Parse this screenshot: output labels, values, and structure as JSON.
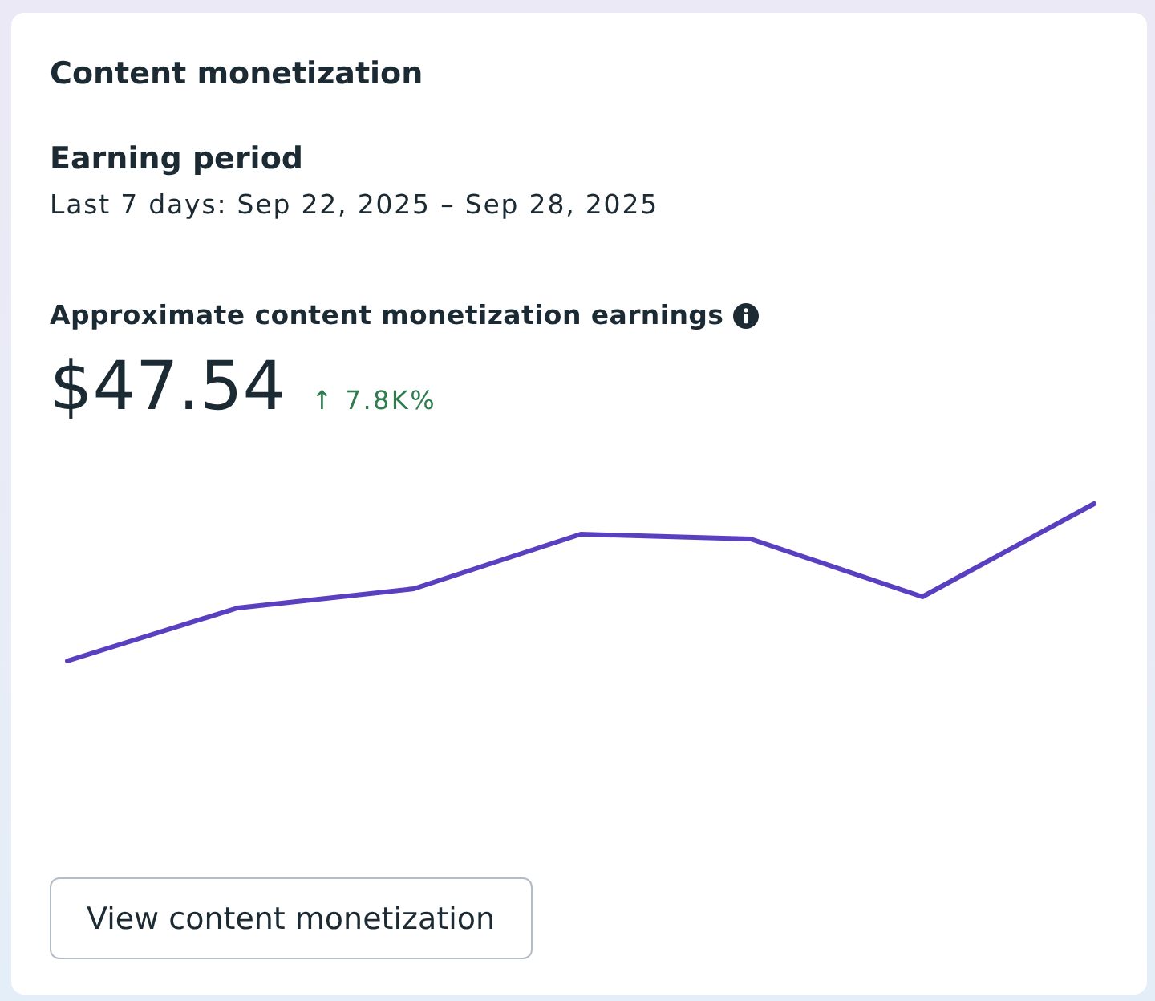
{
  "card": {
    "title": "Content monetization",
    "period_label": "Earning period",
    "period_value": "Last 7 days: Sep 22, 2025 – Sep 28, 2025",
    "earnings_label": "Approximate content monetization earnings",
    "earnings_value": "$47.54",
    "change": {
      "text": "↑ 7.8K%",
      "positive": true
    },
    "button": "View content monetization"
  }
}
